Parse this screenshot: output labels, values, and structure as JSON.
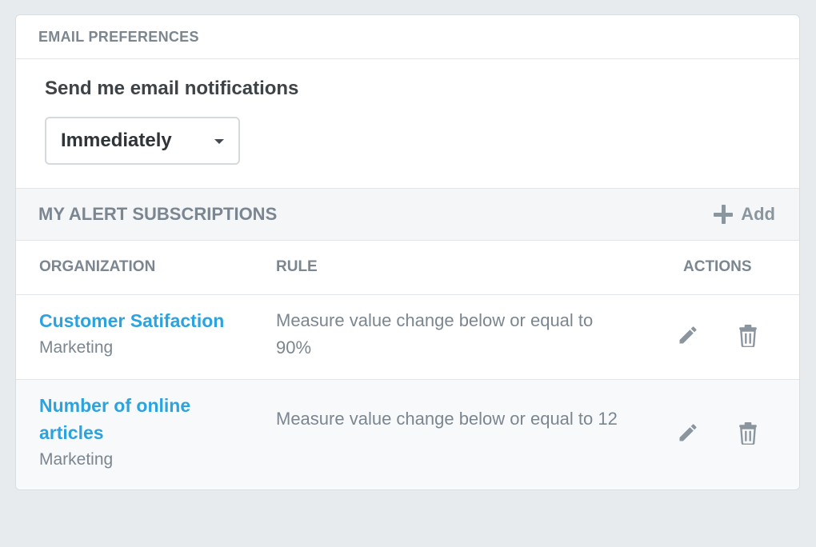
{
  "email_preferences": {
    "header": "EMAIL PREFERENCES",
    "label": "Send me email notifications",
    "frequency_selected": "Immediately"
  },
  "subscriptions": {
    "title": "MY ALERT SUBSCRIPTIONS",
    "add_label": "Add",
    "columns": {
      "organization": "ORGANIZATION",
      "rule": "RULE",
      "actions": "ACTIONS"
    },
    "rows": [
      {
        "name": "Customer Satifaction",
        "organization": "Marketing",
        "rule": "Measure value change below or equal to 90%"
      },
      {
        "name": "Number of online articles",
        "organization": "Marketing",
        "rule": "Measure value change below or equal to 12"
      }
    ]
  },
  "icons": {
    "add": "plus-icon",
    "edit": "pencil-icon",
    "delete": "trash-icon",
    "dropdown": "caret-down-icon"
  },
  "colors": {
    "link": "#2aa3e0",
    "muted": "#7b8690",
    "icon": "#8b959e"
  }
}
